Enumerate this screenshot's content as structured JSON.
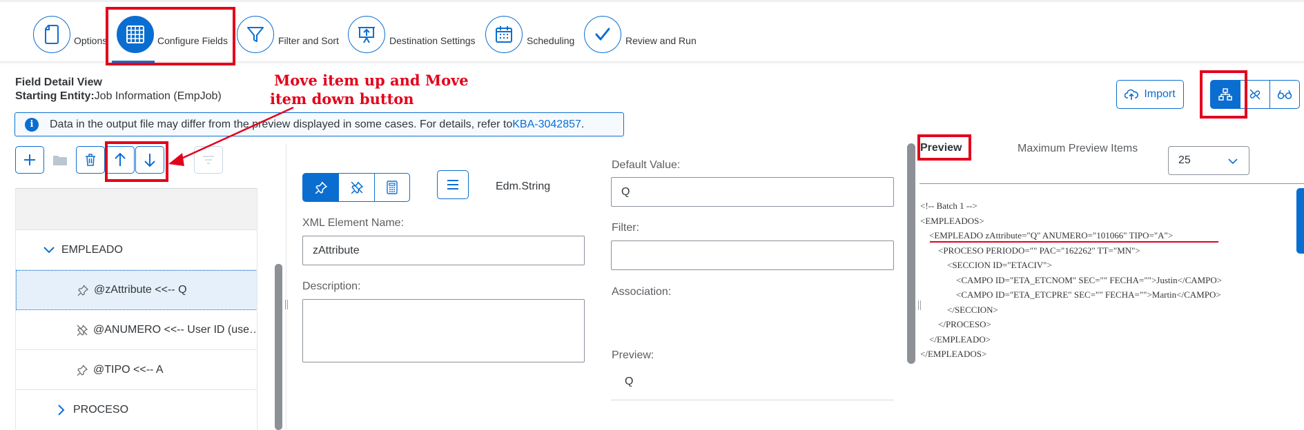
{
  "wizard": {
    "steps": [
      {
        "label": "Options",
        "icon": "document-icon"
      },
      {
        "label": "Configure Fields",
        "icon": "table-grid-icon"
      },
      {
        "label": "Filter and Sort",
        "icon": "filter-funnel-icon"
      },
      {
        "label": "Destination Settings",
        "icon": "presentation-export-icon"
      },
      {
        "label": "Scheduling",
        "icon": "calendar-icon"
      },
      {
        "label": "Review and Run",
        "icon": "checkmark-icon"
      }
    ],
    "active_step": 1
  },
  "annotation": {
    "text_line1": "Move item up and Move",
    "text_line2": "item down button",
    "color": "#e3001b"
  },
  "header": {
    "view_title": "Field Detail View",
    "entity_label": "Starting Entity:",
    "entity_value": "Job Information (EmpJob)"
  },
  "info_strip": {
    "text": "Data in the output file may differ from the preview displayed in some cases. For details, refer to ",
    "link": "KBA-3042857",
    "suffix": "."
  },
  "toolbar_right": {
    "import_label": "Import",
    "view_modes": [
      "hierarchy-icon",
      "unlink-icon",
      "glasses-icon"
    ]
  },
  "tree": {
    "toolbar": [
      "add-icon",
      "folder-icon",
      "delete-icon",
      "arrow-up-icon",
      "arrow-down-icon",
      "sort-icon"
    ],
    "rows": [
      {
        "label": "EMPLEADO",
        "expanded": true
      },
      {
        "label": "@zAttribute <<-- Q",
        "icon": "pin-icon",
        "selected": true
      },
      {
        "label": "@ANUMERO <<-- User ID (use…",
        "icon": "unpin-icon"
      },
      {
        "label": "@TIPO <<-- A",
        "icon": "pin-icon"
      },
      {
        "label": "PROCESO",
        "expanded": false
      }
    ]
  },
  "detail": {
    "type_label": "Edm.String",
    "default_value_label": "Default Value:",
    "default_value": "Q",
    "xml_name_label": "XML Element Name:",
    "xml_name": "zAttribute",
    "filter_label": "Filter:",
    "filter_value": "",
    "description_label": "Description:",
    "description_value": "",
    "association_label": "Association:",
    "preview_label": "Preview:",
    "preview_value": "Q"
  },
  "preview": {
    "title": "Preview",
    "max_items_label": "Maximum Preview Items",
    "max_items_value": "25",
    "xml_lines": [
      "<!-- Batch 1 -->",
      "<EMPLEADOS>",
      "    <EMPLEADO zAttribute=\"Q\" ANUMERO=\"101066\" TIPO=\"A\">",
      "        <PROCESO PERIODO=\"\" PAC=\"162262\" TT=\"MN\">",
      "            <SECCION ID=\"ETACIV\">",
      "                <CAMPO ID=\"ETA_ETCNOM\" SEC=\"\" FECHA=\"\">Justin</CAMPO>",
      "                <CAMPO ID=\"ETA_ETCPRE\" SEC=\"\" FECHA=\"\">Martin</CAMPO>",
      "            </SECCION>",
      "        </PROCESO>",
      "    </EMPLEADO>",
      "</EMPLEADOS>"
    ]
  }
}
